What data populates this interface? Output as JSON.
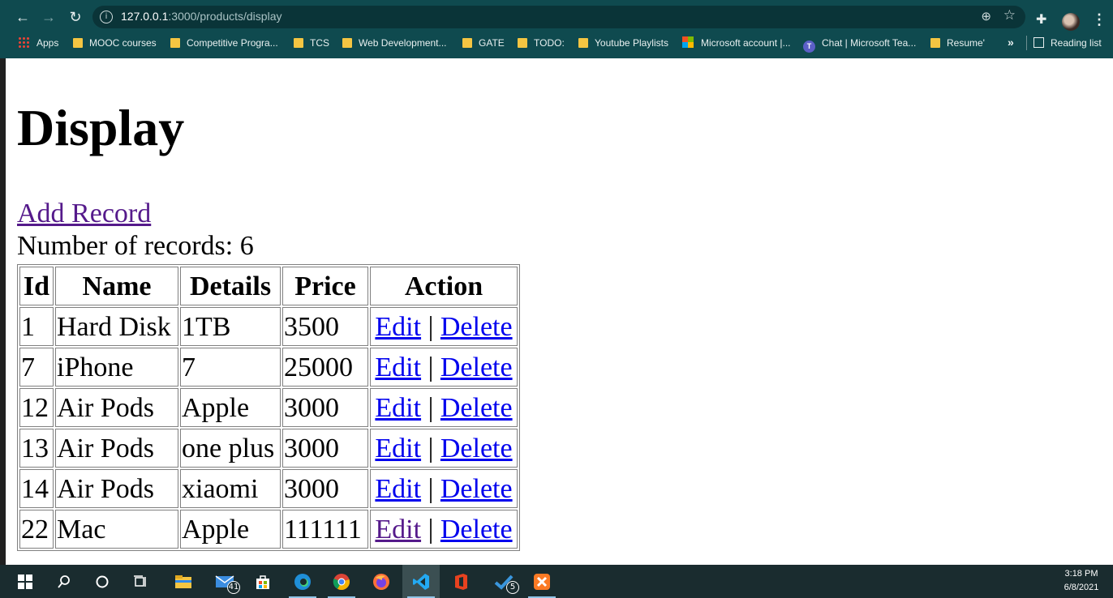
{
  "browser": {
    "url_host": "127.0.0.1",
    "url_path": ":3000/products/display",
    "bookmarks": [
      {
        "label": "Apps",
        "icon": "apps-grid-icon"
      },
      {
        "label": "MOOC courses",
        "icon": "folder-icon"
      },
      {
        "label": "Competitive Progra...",
        "icon": "folder-icon"
      },
      {
        "label": "TCS",
        "icon": "folder-icon"
      },
      {
        "label": "Web Development...",
        "icon": "folder-icon"
      },
      {
        "label": "GATE",
        "icon": "folder-icon"
      },
      {
        "label": "TODO:",
        "icon": "folder-icon"
      },
      {
        "label": "Youtube Playlists",
        "icon": "folder-icon"
      },
      {
        "label": "Microsoft account |...",
        "icon": "microsoft-icon"
      },
      {
        "label": "Chat | Microsoft Tea...",
        "icon": "teams-icon"
      },
      {
        "label": "Resume'",
        "icon": "folder-icon"
      }
    ],
    "more_label": "»",
    "reading_list": "Reading list"
  },
  "page": {
    "title": "Display",
    "add_record": "Add Record",
    "record_count": "Number of records: 6"
  },
  "table": {
    "headers": [
      "Id",
      "Name",
      "Details",
      "Price",
      "Action"
    ],
    "rows": [
      {
        "id": "1",
        "name": "Hard Disk",
        "details": "1TB",
        "price": "3500"
      },
      {
        "id": "7",
        "name": "iPhone",
        "details": "7",
        "price": "25000"
      },
      {
        "id": "12",
        "name": "Air Pods",
        "details": "Apple",
        "price": "3000"
      },
      {
        "id": "13",
        "name": "Air Pods",
        "details": "one plus",
        "price": "3000"
      },
      {
        "id": "14",
        "name": "Air Pods",
        "details": "xiaomi",
        "price": "3000"
      },
      {
        "id": "22",
        "name": "Mac",
        "details": "Apple",
        "price": "111111"
      }
    ],
    "edit_label": "Edit",
    "separator": "|",
    "delete_label": "Delete"
  },
  "taskbar": {
    "mail_badge": "41",
    "todo_badge": "5",
    "time": "3:18 PM",
    "date": "6/8/2021"
  },
  "colors": {
    "chrome_bg": "#0f4a4f",
    "link": "#0000ee",
    "visited_link": "#551a8b",
    "taskbar_bg": "#1a2c2f"
  }
}
